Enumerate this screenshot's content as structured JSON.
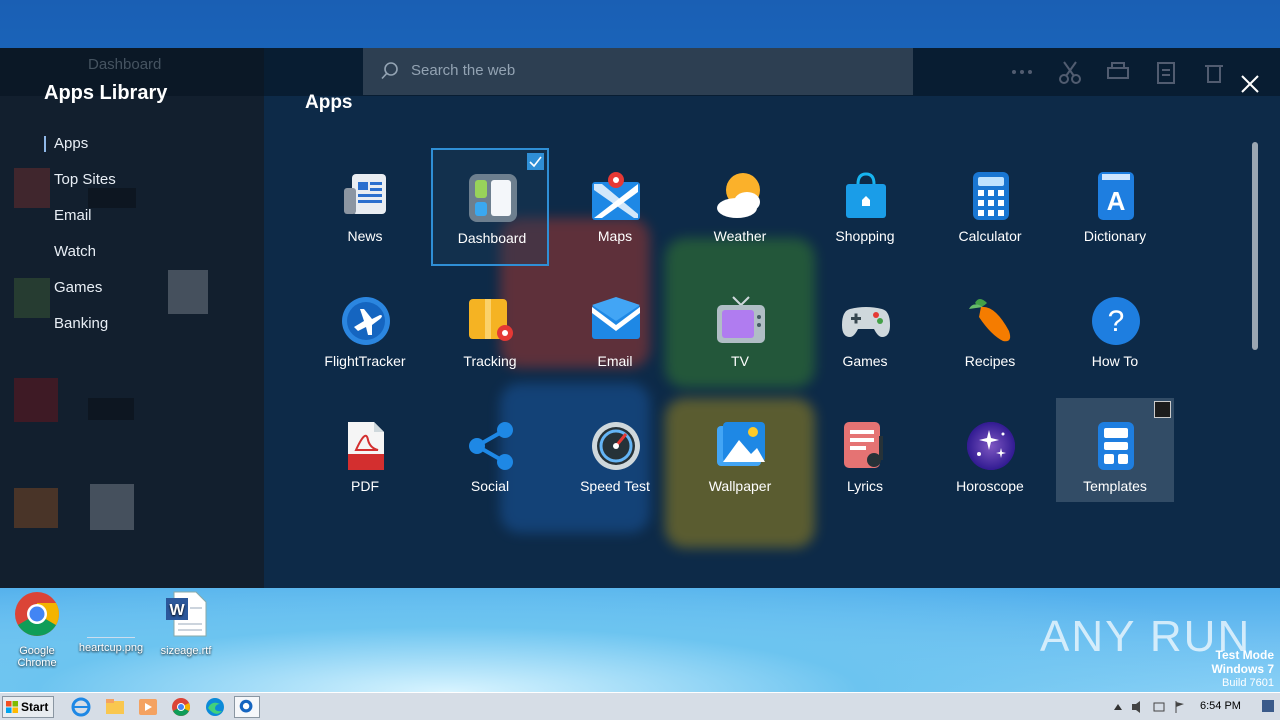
{
  "library": {
    "title": "Apps Library",
    "nav": [
      "Apps",
      "Top Sites",
      "Email",
      "Watch",
      "Games",
      "Banking"
    ]
  },
  "search": {
    "placeholder": "Search the web"
  },
  "ghost_tab": "Dashboard",
  "section_title": "Apps",
  "apps": [
    "News",
    "Dashboard",
    "Maps",
    "Weather",
    "Shopping",
    "Calculator",
    "Dictionary",
    "FlightTracker",
    "Tracking",
    "Email",
    "TV",
    "Games",
    "Recipes",
    "How To",
    "PDF",
    "Social",
    "Speed Test",
    "Wallpaper",
    "Lyrics",
    "Horoscope",
    "Templates"
  ],
  "desktop_icons": [
    {
      "label": "Google Chrome"
    },
    {
      "label": "heartcup.png"
    },
    {
      "label": "sizeage.rtf"
    }
  ],
  "watermark": "ANY RUN",
  "test_mode": {
    "line1": "Test Mode",
    "line2": "Windows 7",
    "line3": "Build 7601"
  },
  "taskbar": {
    "start_label": "Start",
    "clock": "6:54 PM"
  },
  "colors": {
    "accent": "#2f8fd6",
    "overlay": "#0d2a48"
  }
}
